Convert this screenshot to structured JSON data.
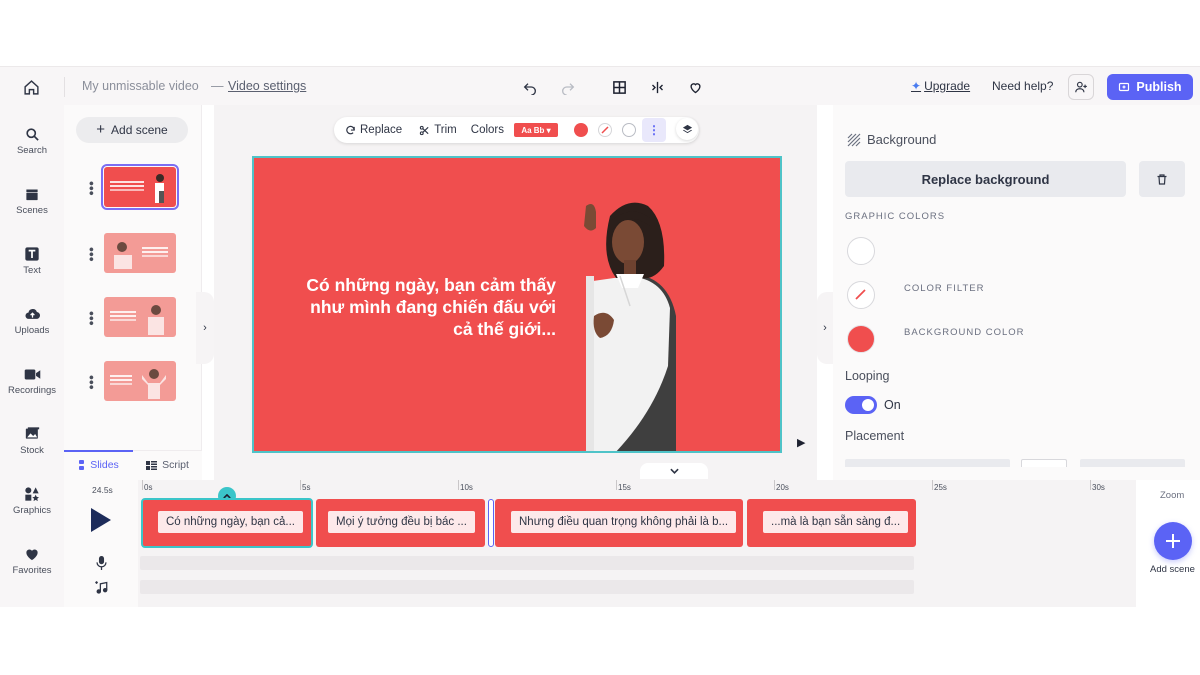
{
  "header": {
    "video_name": "My unmissable video",
    "separator": "—",
    "video_settings": "Video settings",
    "upgrade": "Upgrade",
    "need_help": "Need help?",
    "publish": "Publish"
  },
  "leftnav": {
    "items": [
      {
        "label": "Search",
        "icon": "search-icon"
      },
      {
        "label": "Scenes",
        "icon": "clapperboard-icon"
      },
      {
        "label": "Text",
        "icon": "text-icon"
      },
      {
        "label": "Uploads",
        "icon": "upload-cloud-icon"
      },
      {
        "label": "Recordings",
        "icon": "video-camera-icon"
      },
      {
        "label": "Stock",
        "icon": "image-icon"
      },
      {
        "label": "Graphics",
        "icon": "shapes-icon"
      },
      {
        "label": "Favorites",
        "icon": "heart-icon"
      }
    ]
  },
  "scenes_panel": {
    "add_scene": "Add scene",
    "tab_slides": "Slides",
    "tab_script": "Script"
  },
  "canvas_toolbar": {
    "replace": "Replace",
    "trim": "Trim",
    "colors": "Colors",
    "colors_badge": "Aa Bb"
  },
  "stage": {
    "text": "Có những ngày, bạn cảm thấy như mình đang chiến đấu với cả thế giới..."
  },
  "right_panel": {
    "header": "Background",
    "replace_background": "Replace background",
    "graphic_colors": "GRAPHIC COLORS",
    "color_filter": "COLOR FILTER",
    "background_color": "BACKGROUND COLOR",
    "looping": "Looping",
    "looping_state": "On",
    "placement": "Placement"
  },
  "timeline": {
    "total_time": "24.5s",
    "ticks": [
      "0s",
      "5s",
      "10s",
      "15s",
      "20s",
      "25s",
      "30s"
    ],
    "clips": [
      "Có những ngày, bạn cả...",
      "Mọi ý tưởng đều bị bác ...",
      "Nhưng điều quan trọng không phải là b...",
      "...mà là bạn sẵn sàng đ..."
    ],
    "zoom": "Zoom",
    "add_scene": "Add scene"
  },
  "colors": {
    "accent": "#5b63f5",
    "brand_red": "#f04e4e",
    "playhead": "#3bc5c9"
  }
}
